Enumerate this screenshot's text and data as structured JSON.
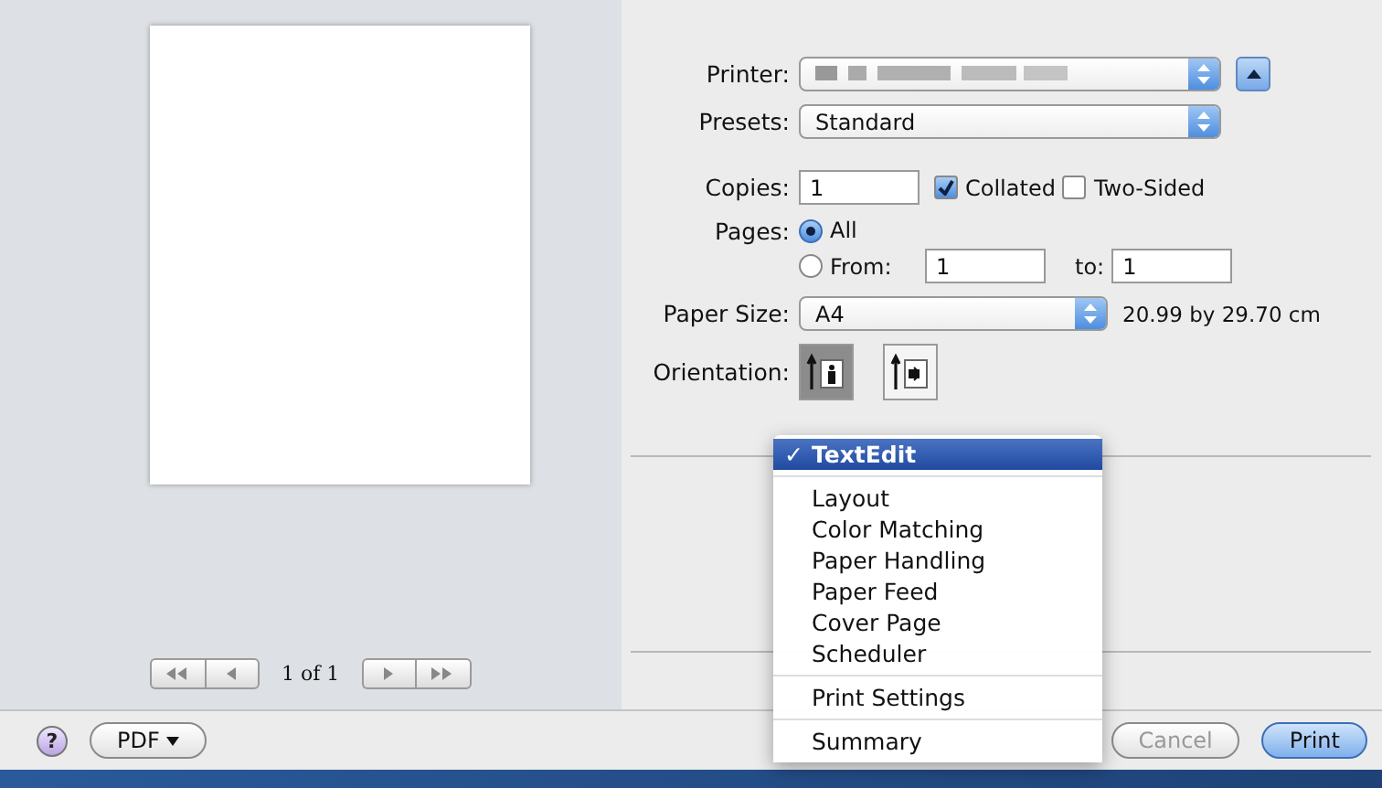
{
  "preview": {
    "page_label": "1 of 1"
  },
  "settings": {
    "printer": {
      "label": "Printer:"
    },
    "presets": {
      "label": "Presets:",
      "value": "Standard"
    },
    "copies": {
      "label": "Copies:",
      "value": "1",
      "collated": {
        "label": "Collated",
        "checked": true
      },
      "two_sided": {
        "label": "Two-Sided",
        "checked": false
      }
    },
    "pages": {
      "label": "Pages:",
      "options": [
        {
          "label": "All",
          "selected": true
        },
        {
          "label": "From:",
          "selected": false
        }
      ],
      "from": "1",
      "to_label": "to:",
      "to": "1"
    },
    "paper_size": {
      "label": "Paper Size:",
      "value": "A4",
      "dimensions": "20.99 by 29.70 cm"
    },
    "orientation": {
      "label": "Orientation:",
      "options": [
        {
          "kind": "portrait",
          "selected": true
        },
        {
          "kind": "landscape",
          "selected": false
        }
      ]
    }
  },
  "menu": {
    "check_mark": "✓",
    "groups": [
      [
        {
          "label": "TextEdit",
          "selected": true
        }
      ],
      [
        {
          "label": "Layout",
          "selected": false
        },
        {
          "label": "Color Matching",
          "selected": false
        },
        {
          "label": "Paper Handling",
          "selected": false
        },
        {
          "label": "Paper Feed",
          "selected": false
        },
        {
          "label": "Cover Page",
          "selected": false
        },
        {
          "label": "Scheduler",
          "selected": false
        }
      ],
      [
        {
          "label": "Print Settings",
          "selected": false
        }
      ],
      [
        {
          "label": "Summary",
          "selected": false
        }
      ]
    ]
  },
  "footer": {
    "help": "?",
    "pdf": "PDF",
    "cancel": {
      "label": "Cancel",
      "disabled": true
    },
    "print": {
      "label": "Print",
      "default": true
    }
  }
}
